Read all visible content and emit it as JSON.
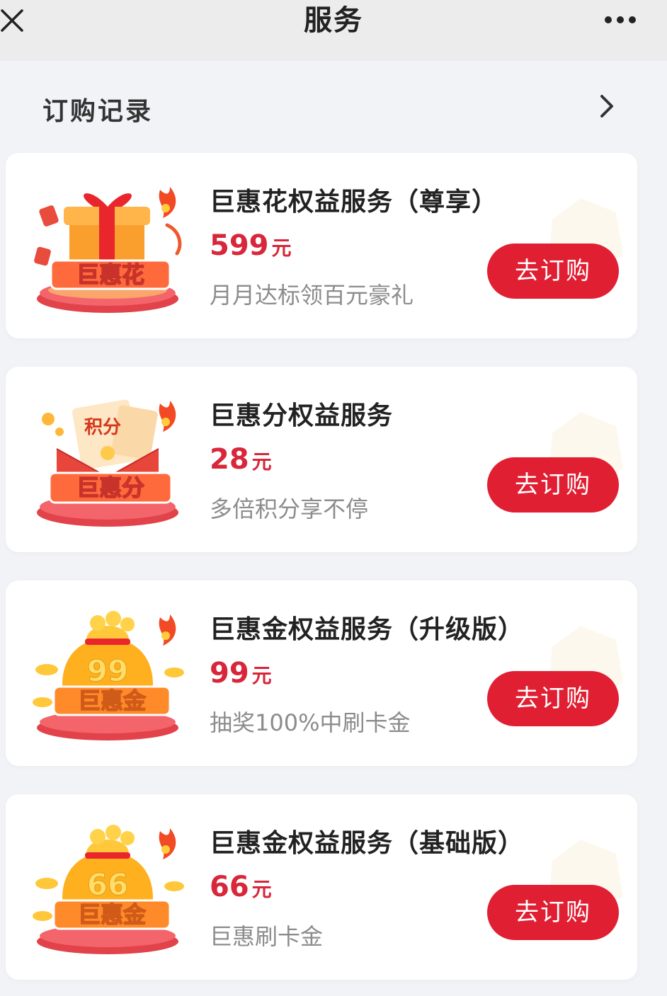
{
  "header": {
    "title": "服务",
    "close_icon": "close-icon",
    "more_icon": "more-icon"
  },
  "records": {
    "label": "订购记录",
    "arrow_icon": "chevron-right-icon"
  },
  "colors": {
    "accent": "#e11f33",
    "price": "#d8263a",
    "background": "#f2f3f7"
  },
  "services": [
    {
      "title": "巨惠花权益服务（尊享）",
      "price": "599",
      "unit": "元",
      "desc": "月月达标领百元豪礼",
      "button": "去订购",
      "badge_text": "巨惠花",
      "icon": "gift-box-icon"
    },
    {
      "title": "巨惠分权益服务",
      "price": "28",
      "unit": "元",
      "desc": "多倍积分享不停",
      "button": "去订购",
      "badge_text": "巨惠分",
      "sub_text": "积分",
      "icon": "points-envelope-icon"
    },
    {
      "title": "巨惠金权益服务（升级版）",
      "price": "99",
      "unit": "元",
      "desc": "抽奖100%中刷卡金",
      "button": "去订购",
      "badge_text": "巨惠金",
      "sub_text": "99",
      "icon": "gold-bag-icon"
    },
    {
      "title": "巨惠金权益服务（基础版）",
      "price": "66",
      "unit": "元",
      "desc": "巨惠刷卡金",
      "button": "去订购",
      "badge_text": "巨惠金",
      "sub_text": "66",
      "icon": "gold-bag-icon"
    }
  ]
}
